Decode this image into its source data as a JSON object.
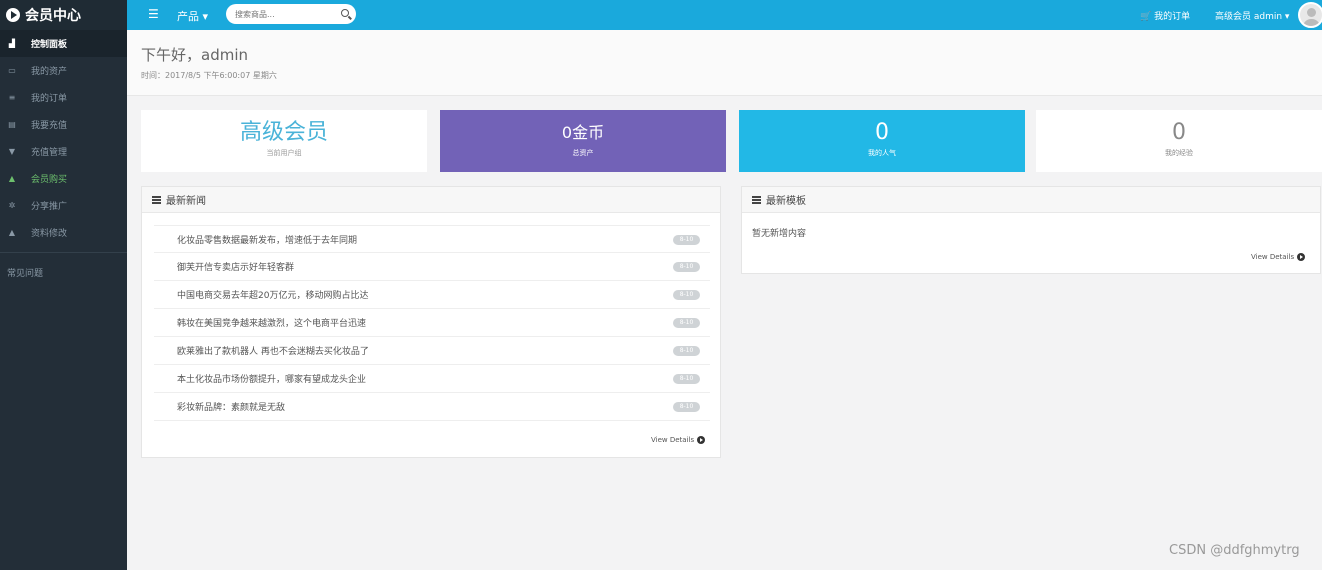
{
  "brand": {
    "title": "会员中心"
  },
  "topbar": {
    "menu_icon": "menu-icon",
    "products_label": "产品 ▾",
    "search_placeholder": "搜索商品...",
    "orders_label": "🛒 我的订单",
    "user_label": "高级会员 admin ▾"
  },
  "sidebar": {
    "items": [
      {
        "label": "控制面板",
        "icon": "▟"
      },
      {
        "label": "我的资产",
        "icon": "▭"
      },
      {
        "label": "我的订单",
        "icon": "≡"
      },
      {
        "label": "我要充值",
        "icon": "▤"
      },
      {
        "label": "充值管理",
        "icon": "▼"
      },
      {
        "label": "会员购买",
        "icon": "▲"
      },
      {
        "label": "分享推广",
        "icon": "✲"
      },
      {
        "label": "资料修改",
        "icon": "▲"
      }
    ],
    "extra": "常见问题"
  },
  "header": {
    "greeting": "下午好，admin",
    "time": "时间：2017/8/5 下午6:00:07 星期六"
  },
  "stats": [
    {
      "value": "高级会员",
      "label": "当前用户组"
    },
    {
      "value": "0金币",
      "label": "总资产"
    },
    {
      "value": "0",
      "label": "我的人气"
    },
    {
      "value": "0",
      "label": "我的经验"
    }
  ],
  "news": {
    "title": "最新新闻",
    "items": [
      {
        "text": "化妆品零售数据最新发布，增速低于去年同期",
        "badge": "8-10"
      },
      {
        "text": "御芙开信专卖店示好年轻客群",
        "badge": "8-10"
      },
      {
        "text": "中国电商交易去年超20万亿元，移动网购占比达",
        "badge": "8-10"
      },
      {
        "text": "韩妆在美国竞争越来越激烈，这个电商平台迅速",
        "badge": "8-10"
      },
      {
        "text": "欧莱雅出了款机器人 再也不会迷糊去买化妆品了",
        "badge": "8-10"
      },
      {
        "text": "本土化妆品市场份额提升，哪家有望成龙头企业",
        "badge": "8-10"
      },
      {
        "text": "彩妆新品牌：素颜就是无敌",
        "badge": "8-10"
      }
    ],
    "view_details": "View Details"
  },
  "notice": {
    "title": "最新模板",
    "empty": "暂无新增内容",
    "view_details": "View Details"
  },
  "watermark": "CSDN @ddfghmytrg"
}
